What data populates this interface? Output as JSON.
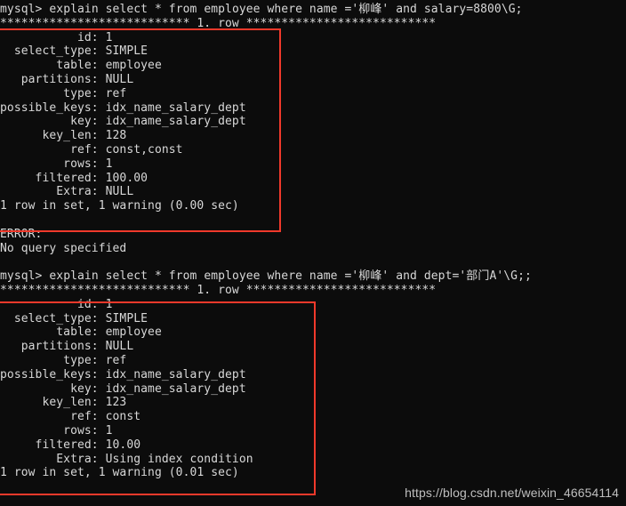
{
  "terminal": {
    "title": "mysql-client-terminal",
    "background_color": "#0c0c0c",
    "text_color": "#d8d8d8",
    "annotation_color": "#f0392b",
    "lines": [
      "mysql> explain select * from employee where name ='柳峰' and salary=8800\\G;",
      "*************************** 1. row ***************************",
      "           id: 1",
      "  select_type: SIMPLE",
      "        table: employee",
      "   partitions: NULL",
      "         type: ref",
      "possible_keys: idx_name_salary_dept",
      "          key: idx_name_salary_dept",
      "      key_len: 128",
      "          ref: const,const",
      "         rows: 1",
      "     filtered: 100.00",
      "        Extra: NULL",
      "1 row in set, 1 warning (0.00 sec)",
      "",
      "ERROR:",
      "No query specified",
      "",
      "mysql> explain select * from employee where name ='柳峰' and dept='部门A'\\G;;",
      "*************************** 1. row ***************************",
      "           id: 1",
      "  select_type: SIMPLE",
      "        table: employee",
      "   partitions: NULL",
      "         type: ref",
      "possible_keys: idx_name_salary_dept",
      "          key: idx_name_salary_dept",
      "      key_len: 123",
      "          ref: const",
      "         rows: 1",
      "     filtered: 10.00",
      "        Extra: Using index condition",
      "1 row in set, 1 warning (0.01 sec)"
    ]
  },
  "query_1": {
    "prompt": "mysql>",
    "sql": "explain select * from employee where name ='柳峰' and salary=8800\\G;",
    "row_separator": "*************************** 1. row ***************************",
    "fields": [
      {
        "label": "id",
        "value": "1"
      },
      {
        "label": "select_type",
        "value": "SIMPLE"
      },
      {
        "label": "table",
        "value": "employee"
      },
      {
        "label": "partitions",
        "value": "NULL"
      },
      {
        "label": "type",
        "value": "ref"
      },
      {
        "label": "possible_keys",
        "value": "idx_name_salary_dept"
      },
      {
        "label": "key",
        "value": "idx_name_salary_dept"
      },
      {
        "label": "key_len",
        "value": "128"
      },
      {
        "label": "ref",
        "value": "const,const"
      },
      {
        "label": "rows",
        "value": "1"
      },
      {
        "label": "filtered",
        "value": "100.00"
      },
      {
        "label": "Extra",
        "value": "NULL"
      }
    ],
    "status": "1 row in set, 1 warning (0.00 sec)"
  },
  "error_block": {
    "title": "ERROR:",
    "message": "No query specified"
  },
  "query_2": {
    "prompt": "mysql>",
    "sql": "explain select * from employee where name ='柳峰' and dept='部门A'\\G;;",
    "row_separator": "*************************** 1. row ***************************",
    "fields": [
      {
        "label": "id",
        "value": "1"
      },
      {
        "label": "select_type",
        "value": "SIMPLE"
      },
      {
        "label": "table",
        "value": "employee"
      },
      {
        "label": "partitions",
        "value": "NULL"
      },
      {
        "label": "type",
        "value": "ref"
      },
      {
        "label": "possible_keys",
        "value": "idx_name_salary_dept"
      },
      {
        "label": "key",
        "value": "idx_name_salary_dept"
      },
      {
        "label": "key_len",
        "value": "123"
      },
      {
        "label": "ref",
        "value": "const"
      },
      {
        "label": "rows",
        "value": "1"
      },
      {
        "label": "filtered",
        "value": "10.00"
      },
      {
        "label": "Extra",
        "value": "Using index condition"
      }
    ],
    "status": "1 row in set, 1 warning (0.01 sec)"
  },
  "annotations": {
    "box_1_label": "highlight-first-explain-result",
    "box_2_label": "highlight-second-explain-result"
  },
  "watermark": {
    "text": "https://blog.csdn.net/weixin_46654114"
  }
}
